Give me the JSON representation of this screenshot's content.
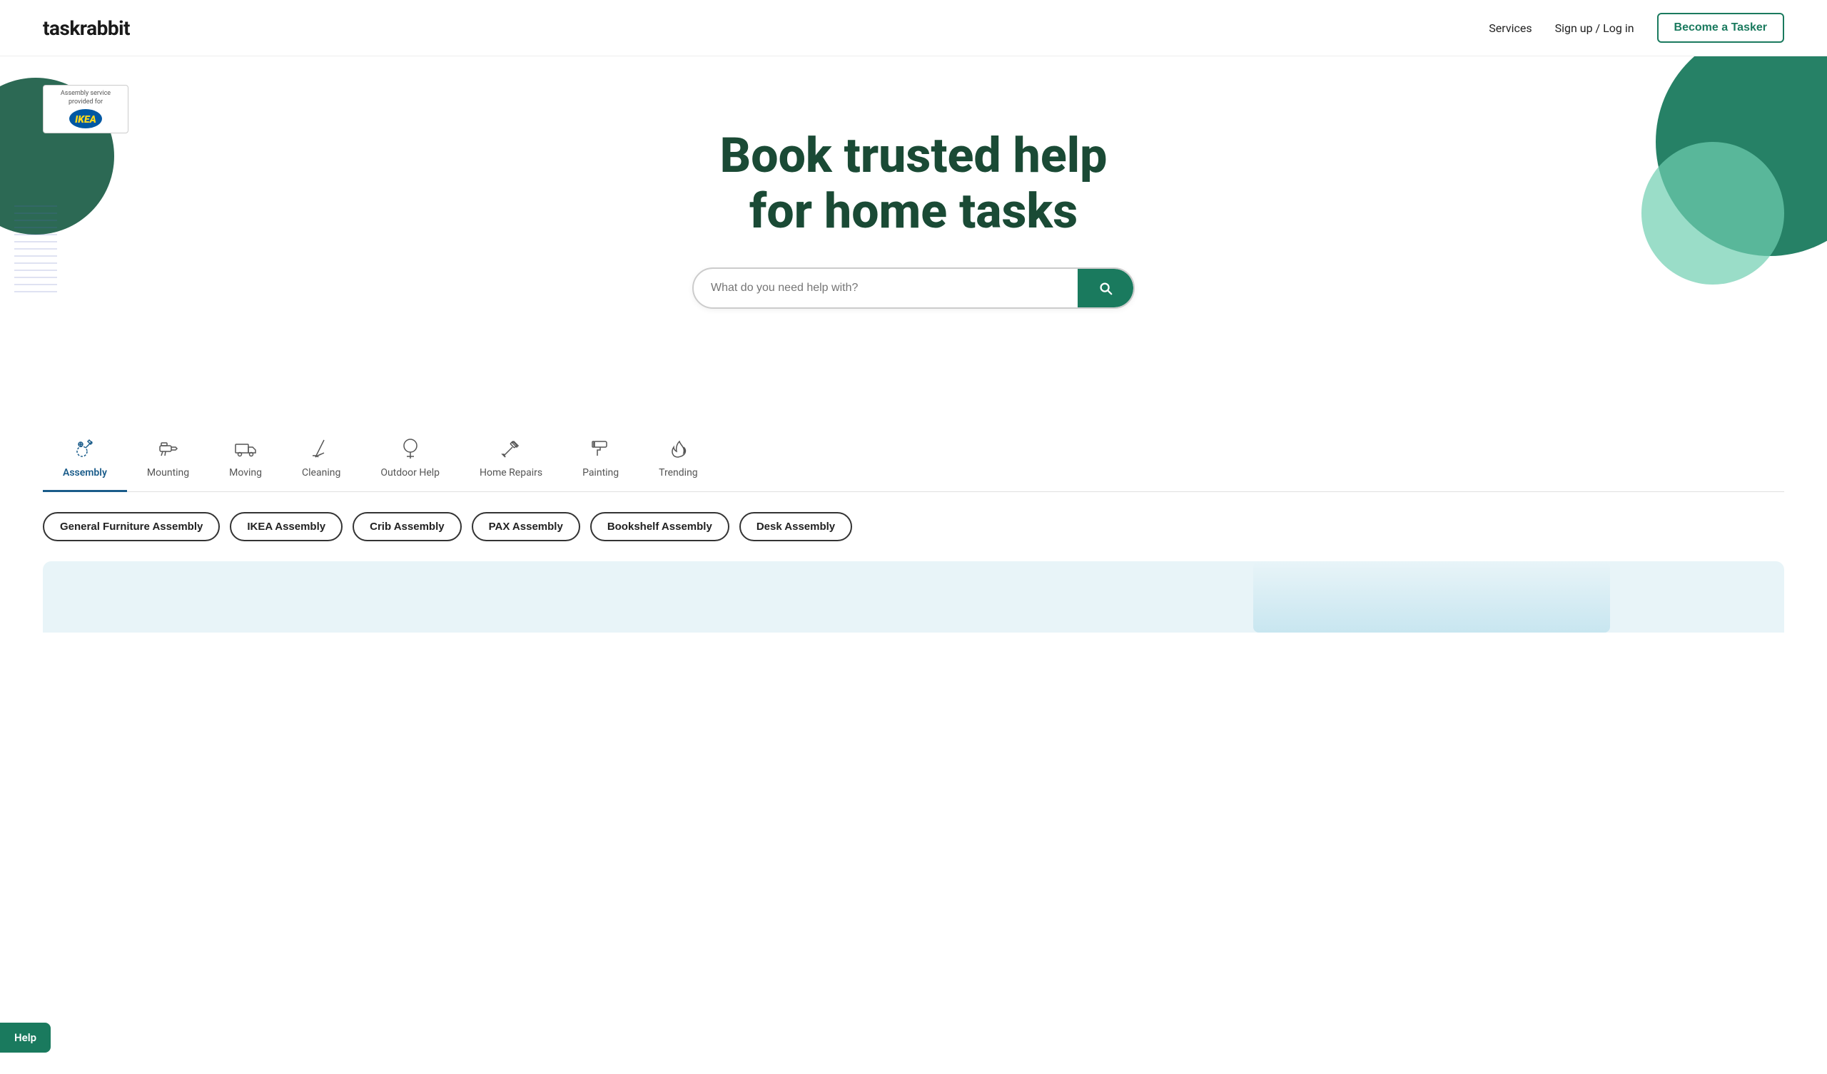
{
  "header": {
    "logo": "taskrabbit",
    "nav": {
      "services_label": "Services",
      "auth_label": "Sign up / Log in",
      "cta_label": "Become a Tasker"
    }
  },
  "ikea_badge": {
    "text": "Assembly service provided for",
    "logo_text": "IKEA"
  },
  "hero": {
    "title_line1": "Book trusted help",
    "title_line2": "for home tasks"
  },
  "search": {
    "placeholder": "What do you need help with?"
  },
  "categories": [
    {
      "id": "assembly",
      "label": "Assembly",
      "active": true,
      "icon": "wrench-screwdriver"
    },
    {
      "id": "mounting",
      "label": "Mounting",
      "active": false,
      "icon": "drill"
    },
    {
      "id": "moving",
      "label": "Moving",
      "active": false,
      "icon": "truck"
    },
    {
      "id": "cleaning",
      "label": "Cleaning",
      "active": false,
      "icon": "broom"
    },
    {
      "id": "outdoor",
      "label": "Outdoor Help",
      "active": false,
      "icon": "tree"
    },
    {
      "id": "homerepairs",
      "label": "Home Repairs",
      "active": false,
      "icon": "hammer"
    },
    {
      "id": "painting",
      "label": "Painting",
      "active": false,
      "icon": "paint-roller"
    },
    {
      "id": "trending",
      "label": "Trending",
      "active": false,
      "icon": "flame"
    }
  ],
  "pills": [
    "General Furniture Assembly",
    "IKEA Assembly",
    "Crib Assembly",
    "PAX Assembly",
    "Bookshelf Assembly",
    "Desk Assembly"
  ],
  "help_button": "Help"
}
